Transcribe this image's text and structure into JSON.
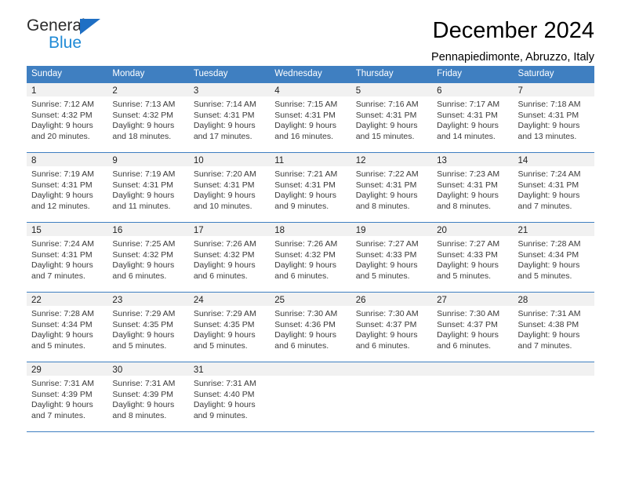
{
  "logo": {
    "word1": "General",
    "word2": "Blue",
    "triangle_color": "#1f6fc4",
    "blue_text_color": "#1f8ad6"
  },
  "header": {
    "title": "December 2024",
    "location": "Pennapiedimonte, Abruzzo, Italy"
  },
  "theme": {
    "header_blue": "#3f7fc1",
    "daynum_band": "#f1f1f1"
  },
  "weekday_headers": [
    "Sunday",
    "Monday",
    "Tuesday",
    "Wednesday",
    "Thursday",
    "Friday",
    "Saturday"
  ],
  "weeks": [
    [
      {
        "day": "1",
        "sunrise": "Sunrise: 7:12 AM",
        "sunset": "Sunset: 4:32 PM",
        "daylight1": "Daylight: 9 hours",
        "daylight2": "and 20 minutes."
      },
      {
        "day": "2",
        "sunrise": "Sunrise: 7:13 AM",
        "sunset": "Sunset: 4:32 PM",
        "daylight1": "Daylight: 9 hours",
        "daylight2": "and 18 minutes."
      },
      {
        "day": "3",
        "sunrise": "Sunrise: 7:14 AM",
        "sunset": "Sunset: 4:31 PM",
        "daylight1": "Daylight: 9 hours",
        "daylight2": "and 17 minutes."
      },
      {
        "day": "4",
        "sunrise": "Sunrise: 7:15 AM",
        "sunset": "Sunset: 4:31 PM",
        "daylight1": "Daylight: 9 hours",
        "daylight2": "and 16 minutes."
      },
      {
        "day": "5",
        "sunrise": "Sunrise: 7:16 AM",
        "sunset": "Sunset: 4:31 PM",
        "daylight1": "Daylight: 9 hours",
        "daylight2": "and 15 minutes."
      },
      {
        "day": "6",
        "sunrise": "Sunrise: 7:17 AM",
        "sunset": "Sunset: 4:31 PM",
        "daylight1": "Daylight: 9 hours",
        "daylight2": "and 14 minutes."
      },
      {
        "day": "7",
        "sunrise": "Sunrise: 7:18 AM",
        "sunset": "Sunset: 4:31 PM",
        "daylight1": "Daylight: 9 hours",
        "daylight2": "and 13 minutes."
      }
    ],
    [
      {
        "day": "8",
        "sunrise": "Sunrise: 7:19 AM",
        "sunset": "Sunset: 4:31 PM",
        "daylight1": "Daylight: 9 hours",
        "daylight2": "and 12 minutes."
      },
      {
        "day": "9",
        "sunrise": "Sunrise: 7:19 AM",
        "sunset": "Sunset: 4:31 PM",
        "daylight1": "Daylight: 9 hours",
        "daylight2": "and 11 minutes."
      },
      {
        "day": "10",
        "sunrise": "Sunrise: 7:20 AM",
        "sunset": "Sunset: 4:31 PM",
        "daylight1": "Daylight: 9 hours",
        "daylight2": "and 10 minutes."
      },
      {
        "day": "11",
        "sunrise": "Sunrise: 7:21 AM",
        "sunset": "Sunset: 4:31 PM",
        "daylight1": "Daylight: 9 hours",
        "daylight2": "and 9 minutes."
      },
      {
        "day": "12",
        "sunrise": "Sunrise: 7:22 AM",
        "sunset": "Sunset: 4:31 PM",
        "daylight1": "Daylight: 9 hours",
        "daylight2": "and 8 minutes."
      },
      {
        "day": "13",
        "sunrise": "Sunrise: 7:23 AM",
        "sunset": "Sunset: 4:31 PM",
        "daylight1": "Daylight: 9 hours",
        "daylight2": "and 8 minutes."
      },
      {
        "day": "14",
        "sunrise": "Sunrise: 7:24 AM",
        "sunset": "Sunset: 4:31 PM",
        "daylight1": "Daylight: 9 hours",
        "daylight2": "and 7 minutes."
      }
    ],
    [
      {
        "day": "15",
        "sunrise": "Sunrise: 7:24 AM",
        "sunset": "Sunset: 4:31 PM",
        "daylight1": "Daylight: 9 hours",
        "daylight2": "and 7 minutes."
      },
      {
        "day": "16",
        "sunrise": "Sunrise: 7:25 AM",
        "sunset": "Sunset: 4:32 PM",
        "daylight1": "Daylight: 9 hours",
        "daylight2": "and 6 minutes."
      },
      {
        "day": "17",
        "sunrise": "Sunrise: 7:26 AM",
        "sunset": "Sunset: 4:32 PM",
        "daylight1": "Daylight: 9 hours",
        "daylight2": "and 6 minutes."
      },
      {
        "day": "18",
        "sunrise": "Sunrise: 7:26 AM",
        "sunset": "Sunset: 4:32 PM",
        "daylight1": "Daylight: 9 hours",
        "daylight2": "and 6 minutes."
      },
      {
        "day": "19",
        "sunrise": "Sunrise: 7:27 AM",
        "sunset": "Sunset: 4:33 PM",
        "daylight1": "Daylight: 9 hours",
        "daylight2": "and 5 minutes."
      },
      {
        "day": "20",
        "sunrise": "Sunrise: 7:27 AM",
        "sunset": "Sunset: 4:33 PM",
        "daylight1": "Daylight: 9 hours",
        "daylight2": "and 5 minutes."
      },
      {
        "day": "21",
        "sunrise": "Sunrise: 7:28 AM",
        "sunset": "Sunset: 4:34 PM",
        "daylight1": "Daylight: 9 hours",
        "daylight2": "and 5 minutes."
      }
    ],
    [
      {
        "day": "22",
        "sunrise": "Sunrise: 7:28 AM",
        "sunset": "Sunset: 4:34 PM",
        "daylight1": "Daylight: 9 hours",
        "daylight2": "and 5 minutes."
      },
      {
        "day": "23",
        "sunrise": "Sunrise: 7:29 AM",
        "sunset": "Sunset: 4:35 PM",
        "daylight1": "Daylight: 9 hours",
        "daylight2": "and 5 minutes."
      },
      {
        "day": "24",
        "sunrise": "Sunrise: 7:29 AM",
        "sunset": "Sunset: 4:35 PM",
        "daylight1": "Daylight: 9 hours",
        "daylight2": "and 5 minutes."
      },
      {
        "day": "25",
        "sunrise": "Sunrise: 7:30 AM",
        "sunset": "Sunset: 4:36 PM",
        "daylight1": "Daylight: 9 hours",
        "daylight2": "and 6 minutes."
      },
      {
        "day": "26",
        "sunrise": "Sunrise: 7:30 AM",
        "sunset": "Sunset: 4:37 PM",
        "daylight1": "Daylight: 9 hours",
        "daylight2": "and 6 minutes."
      },
      {
        "day": "27",
        "sunrise": "Sunrise: 7:30 AM",
        "sunset": "Sunset: 4:37 PM",
        "daylight1": "Daylight: 9 hours",
        "daylight2": "and 6 minutes."
      },
      {
        "day": "28",
        "sunrise": "Sunrise: 7:31 AM",
        "sunset": "Sunset: 4:38 PM",
        "daylight1": "Daylight: 9 hours",
        "daylight2": "and 7 minutes."
      }
    ],
    [
      {
        "day": "29",
        "sunrise": "Sunrise: 7:31 AM",
        "sunset": "Sunset: 4:39 PM",
        "daylight1": "Daylight: 9 hours",
        "daylight2": "and 7 minutes."
      },
      {
        "day": "30",
        "sunrise": "Sunrise: 7:31 AM",
        "sunset": "Sunset: 4:39 PM",
        "daylight1": "Daylight: 9 hours",
        "daylight2": "and 8 minutes."
      },
      {
        "day": "31",
        "sunrise": "Sunrise: 7:31 AM",
        "sunset": "Sunset: 4:40 PM",
        "daylight1": "Daylight: 9 hours",
        "daylight2": "and 9 minutes."
      },
      {
        "day": "",
        "sunrise": "",
        "sunset": "",
        "daylight1": "",
        "daylight2": ""
      },
      {
        "day": "",
        "sunrise": "",
        "sunset": "",
        "daylight1": "",
        "daylight2": ""
      },
      {
        "day": "",
        "sunrise": "",
        "sunset": "",
        "daylight1": "",
        "daylight2": ""
      },
      {
        "day": "",
        "sunrise": "",
        "sunset": "",
        "daylight1": "",
        "daylight2": ""
      }
    ]
  ]
}
